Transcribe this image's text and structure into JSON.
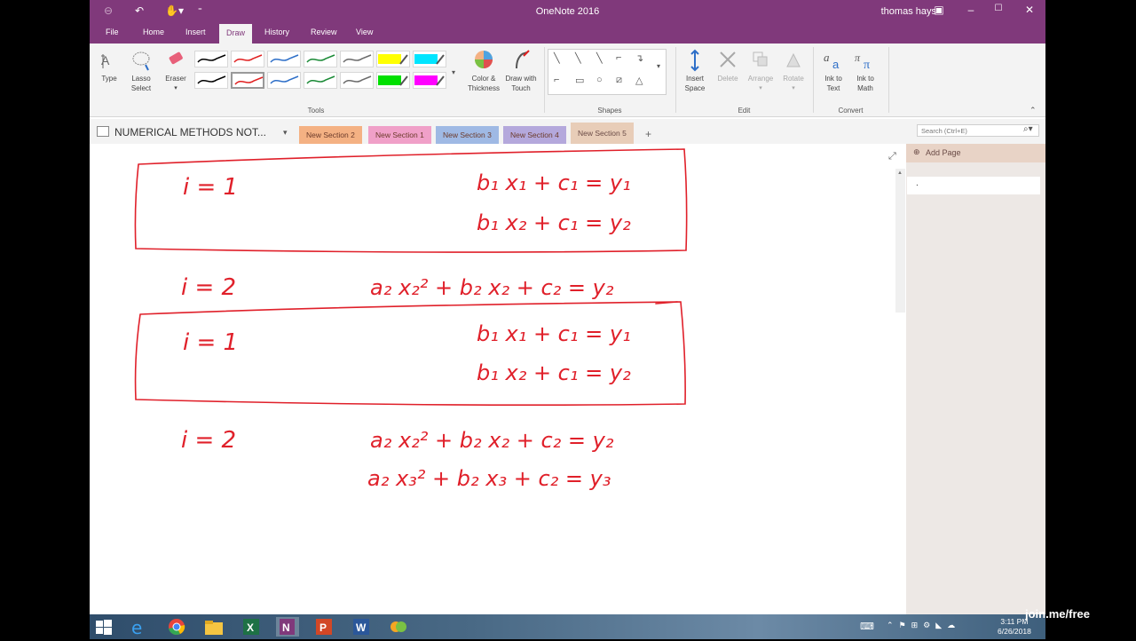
{
  "window": {
    "title": "OneNote 2016",
    "user": "thomas hays",
    "minimize": "–",
    "restore": "☐",
    "close": "✕"
  },
  "ribbon_tabs": [
    "File",
    "Home",
    "Insert",
    "Draw",
    "History",
    "Review",
    "View"
  ],
  "active_tab": "Draw",
  "tools_group": {
    "type_label": "Type",
    "lasso_label": "Lasso Select",
    "eraser_label": "Eraser",
    "color_label": "Color & Thickness",
    "touch_label": "Draw with Touch",
    "group_label": "Tools"
  },
  "pen_colors_row1": [
    "#000000",
    "#e02020",
    "#2e6fc8",
    "#1a8a36",
    "#6a6a6a",
    "#ffff00",
    "#00e5ff"
  ],
  "pen_colors_row2": [
    "#000000",
    "#e02020",
    "#2e6fc8",
    "#1a8a36",
    "#6a6a6a",
    "#00e000",
    "#ff00ff"
  ],
  "shapes_group": {
    "group_label": "Shapes"
  },
  "edit_group": {
    "insert_space": "Insert Space",
    "delete": "Delete",
    "arrange": "Arrange",
    "rotate": "Rotate",
    "group_label": "Edit"
  },
  "convert_group": {
    "ink_to_text": "Ink to Text",
    "ink_to_math": "Ink to Math",
    "group_label": "Convert"
  },
  "notebook": {
    "name": "NUMERICAL METHODS NOT...",
    "sections": [
      {
        "label": "New Section 2",
        "color": "#f4b183"
      },
      {
        "label": "New Section 1",
        "color": "#f0a0c8"
      },
      {
        "label": "New Section 3",
        "color": "#9fb9e4"
      },
      {
        "label": "New Section 4",
        "color": "#b4a8dc"
      },
      {
        "label": "New Section 5",
        "color": "#e8cdb8"
      }
    ],
    "add_section": "+"
  },
  "search": {
    "placeholder": "Search (Ctrl+E)"
  },
  "pages_pane": {
    "add_page": "Add Page",
    "page_item": "."
  },
  "ink_notes": {
    "block1": {
      "i": "i = 1",
      "eq1": "b₁ x₁ + c₁ = y₁",
      "eq2": "b₁ x₂ + c₁ = y₂"
    },
    "block2": {
      "i": "i = 2",
      "eq1": "a₂ x₂² + b₂ x₂ + c₂ = y₂"
    },
    "block3": {
      "i": "i = 1",
      "eq1": "b₁ x₁ + c₁ = y₁",
      "eq2": "b₁ x₂ + c₁ = y₂"
    },
    "block4": {
      "i": "i = 2",
      "eq1": "a₂ x₂² + b₂ x₂ + c₂ = y₂",
      "eq2": "a₂ x₃² + b₂ x₃ + c₂ = y₃"
    }
  },
  "taskbar": {
    "time": "3:11 PM",
    "date": "6/26/2018",
    "apps": [
      "start",
      "edge",
      "chrome",
      "file-explorer",
      "excel",
      "onenote",
      "powerpoint",
      "word",
      "joinme"
    ]
  },
  "watermark": "join.me/free",
  "colors": {
    "accent": "#80397b",
    "ink": "#e0202a"
  }
}
